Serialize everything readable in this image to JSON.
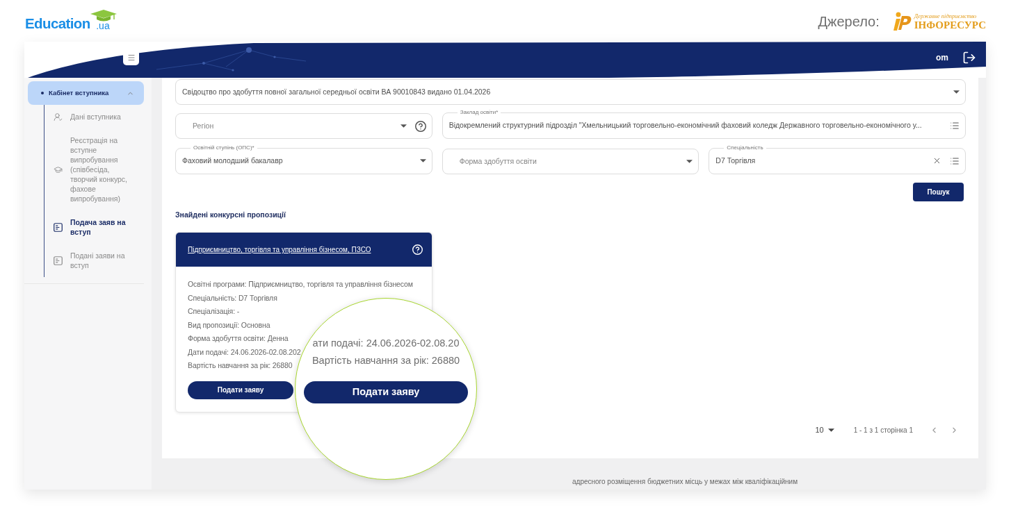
{
  "logo": {
    "name": "Education",
    "domain": ".ua"
  },
  "source": {
    "label": "Джерело:",
    "org_caption": "Державне підприємство",
    "org_name": "ІНФОРЕСУРС"
  },
  "header": {
    "account": "om"
  },
  "sidebar": {
    "label": "Кабінет вступника",
    "expanded": true,
    "items": [
      {
        "label": "Дані вступника",
        "selected": false
      },
      {
        "label": "Реєстрація на вступне випробування (співбесіда, творчий конкурс, фахове випробування)",
        "selected": false
      },
      {
        "label": "Подача заяв на вступ",
        "selected": true
      },
      {
        "label": "Подані заяви на вступ",
        "selected": false
      }
    ]
  },
  "filters": [
    [
      {
        "kind": "dropdown",
        "value": "Свідоцтво про здобуття повної загальної середньої освіти ВА 90010843 видано 01.04.2026",
        "help": false,
        "clearable": false
      }
    ],
    [
      {
        "kind": "dropdown",
        "placeholder": "Регіон",
        "help": true,
        "clearable": false
      },
      {
        "kind": "lookup",
        "label": "Заклад освіти*",
        "value": "Відокремлений структурний підрозділ \"Хмельницький торговельно-економічний фаховий коледж Державного торговельно-економічного у...",
        "help": false,
        "clearable": false
      }
    ],
    [
      {
        "kind": "dropdown",
        "label": "Освітній ступінь (ОПС)*",
        "value": "Фаховий молодший бакалавр",
        "help": false,
        "clearable": false
      },
      {
        "kind": "dropdown",
        "placeholder": "Форма здобуття освіти",
        "help": false,
        "clearable": false
      },
      {
        "kind": "lookup",
        "label": "Спеціальність",
        "value": "D7 Торгівля",
        "help": false,
        "clearable": true
      }
    ]
  ],
  "search_button": "Пошук",
  "results": {
    "title": "Знайдені конкурсні пропозиції",
    "offers": [
      {
        "title": "Підприємництво, торгівля та управління бізнесом, ПЗСО",
        "details": [
          "Освітні програми: Підприємництво, торгівля та управління бізнесом",
          "Спеціальність: D7 Торгівля",
          "Спеціалізація: -",
          "Вид пропозиції: Основна",
          "Форма здобуття освіти: Денна",
          "Дати подачі: 24.06.2026-02.08.202",
          "Вартість навчання за рік: 26880"
        ],
        "apply_button": "Подати заяву"
      }
    ]
  },
  "pagination": {
    "page_size": "10",
    "range": "1 - 1 з 1 сторінка 1"
  },
  "magnifier": {
    "details": [
      "ати подачі: 24.06.2026-02.08.20",
      "Вартість навчання за рік: 26880"
    ],
    "apply_button": "Подати заяву"
  },
  "footnote": "адресного розміщення бюджетних місць у межах між кваліфікаційним"
}
